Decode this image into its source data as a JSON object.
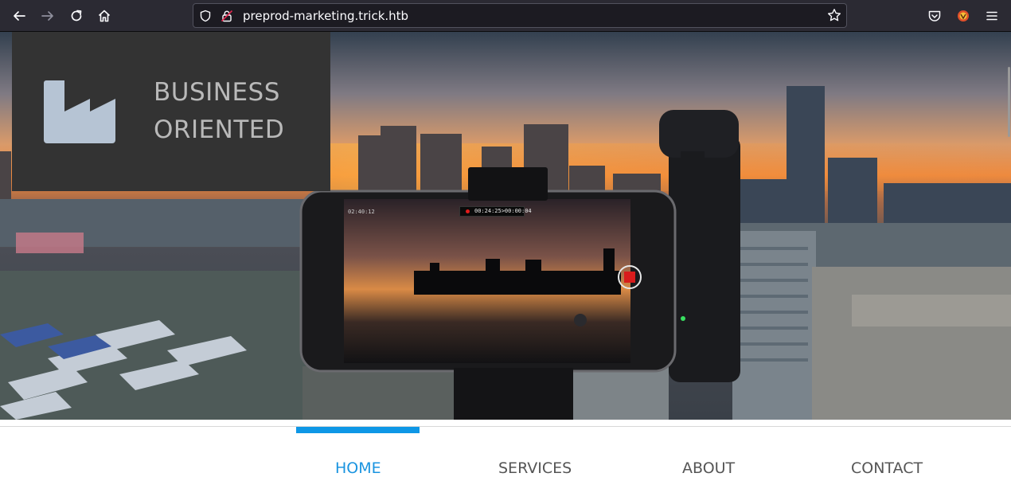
{
  "browser": {
    "url": "preprod-marketing.trick.htb",
    "icons": {
      "back": "arrow-left-icon",
      "forward": "arrow-right-icon",
      "reload": "reload-icon",
      "home": "home-icon",
      "shield": "shield-icon",
      "lock": "lock-icon",
      "bookmark": "star-icon",
      "pocket": "pocket-icon",
      "extension": "extension-icon",
      "menu": "hamburger-menu-icon"
    }
  },
  "logo": {
    "line1": "BUSINESS",
    "line2": "ORIENTED",
    "icon": "factory-icon"
  },
  "hero": {
    "recording_time": "00:24:25>00:00:04",
    "battery_time": "02:40:12"
  },
  "nav": {
    "items": [
      {
        "label": "HOME",
        "active": true
      },
      {
        "label": "SERVICES",
        "active": false
      },
      {
        "label": "ABOUT",
        "active": false
      },
      {
        "label": "CONTACT",
        "active": false
      }
    ]
  },
  "colors": {
    "accent": "#0e97e6",
    "logo_bg": "#333333",
    "logo_text": "#b9b9b9",
    "browser_bg": "#2b2a33"
  }
}
